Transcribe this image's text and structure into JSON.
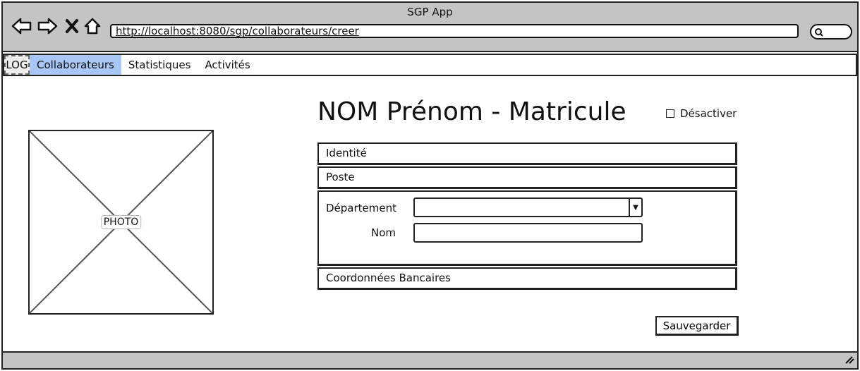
{
  "window": {
    "title": "SGP App"
  },
  "toolbar": {
    "icons": [
      "back-arrow-icon",
      "forward-arrow-icon",
      "close-x-icon",
      "home-icon"
    ],
    "url": "http://localhost:8080/sgp/collaborateurs/creer",
    "search_icon": "search-icon"
  },
  "menu": {
    "logo": "LOG",
    "items": [
      {
        "label": "Collaborateurs",
        "active": true
      },
      {
        "label": "Statistiques",
        "active": false
      },
      {
        "label": "Activités",
        "active": false
      }
    ],
    "active_color": "#a9c7f5"
  },
  "photo": {
    "label": "PHOTO"
  },
  "header": {
    "title": "NOM Prénom - Matricule",
    "deactivate_label": "Désactiver",
    "deactivate_checked": false
  },
  "sections": {
    "identite": "Identité",
    "poste": "Poste",
    "departement_label": "Département",
    "departement_value": "",
    "nom_label": "Nom",
    "nom_value": "",
    "coordonnees": "Coordonnées Bancaires"
  },
  "actions": {
    "save_label": "Sauvegarder"
  },
  "colors": {
    "chrome": "#c4c4c4",
    "border": "#222222"
  }
}
